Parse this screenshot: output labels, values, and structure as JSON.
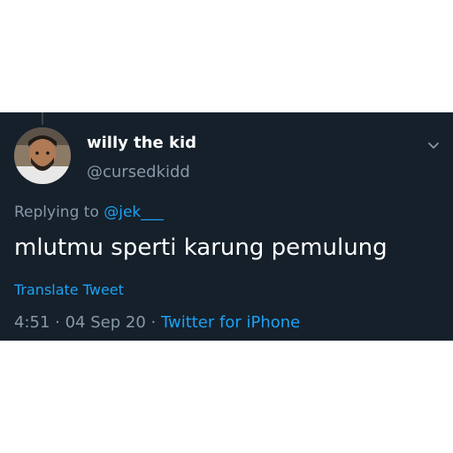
{
  "tweet": {
    "display_name": "willy the kid",
    "handle": "@cursedkidd",
    "replying_prefix": "Replying to ",
    "replying_to": "@jek___",
    "text": "mlutmu sperti karung pemulung",
    "translate_label": "Translate Tweet",
    "time": "4:51",
    "separator": " · ",
    "date": "04 Sep 20",
    "source": "Twitter for iPhone",
    "menu_icon": "chevron-down-icon"
  },
  "colors": {
    "background": "#15202b",
    "primary_text": "#ffffff",
    "secondary_text": "#8899a6",
    "accent": "#1da1f2"
  }
}
